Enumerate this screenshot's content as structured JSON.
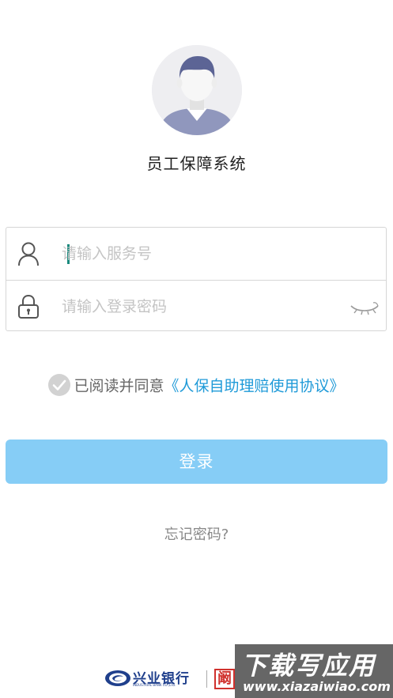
{
  "app": {
    "title": "员工保障系统"
  },
  "login_form": {
    "username_placeholder": "请输入服务号",
    "password_placeholder": "请输入登录密码",
    "user_icon": "user-icon",
    "lock_icon": "lock-icon",
    "eye_icon": "eye-closed-icon"
  },
  "agreement": {
    "checked": true,
    "prefix": "已阅读并同意",
    "link": "《人保自助理赔使用协议》"
  },
  "buttons": {
    "login": "登录",
    "forgot": "忘记密码?"
  },
  "footer": {
    "bank_name": "兴业银行",
    "bank_name_en": "INDUSTRIAL BANK CO.,LTD.",
    "seal_glyph": "阚"
  },
  "watermark": {
    "main": "下载写应用",
    "url": "www.xiazaiwiao.com"
  },
  "colors": {
    "accent": "#86cdf6",
    "link": "#1f9ad8",
    "caret": "#1a8a7e",
    "bank_blue": "#1f3f8c",
    "seal_red": "#d0312d"
  }
}
